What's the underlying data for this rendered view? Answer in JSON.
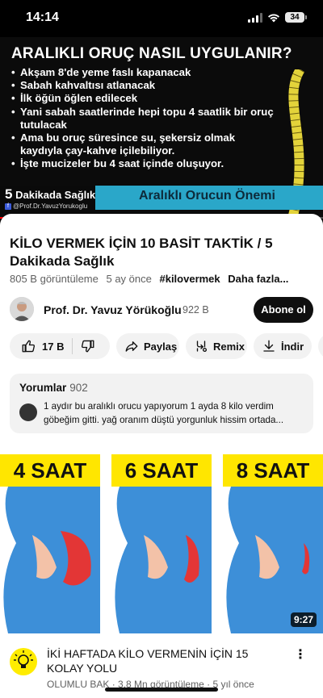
{
  "status_bar": {
    "time": "14:14",
    "battery": "34"
  },
  "player": {
    "headline": "ARALIKLI ORUÇ NASIL UYGULANIR?",
    "bullets": [
      "Akşam 8'de yeme faslı kapanacak",
      "Sabah kahvaltısı atlanacak",
      "İlk öğün öğlen edilecek",
      "Yani sabah saatlerinde hepi topu 4 saatlik bir oruç tutulacak",
      "Ama bu oruç süresince su, şekersiz olmak kaydıyla çay-kahve içilebiliyor.",
      "İşte mucizeler bu 4 saat içinde oluşuyor."
    ],
    "brand_number": "5",
    "brand_name": "Dakikada Sağlık",
    "brand_handle": "@Prof.Dr.YavuzYorukoglu",
    "subtitle": "Aralıklı Orucun Önemi",
    "progress": 0.03
  },
  "video": {
    "title": "KİLO VERMEK İÇİN 10 BASİT TAKTİK / 5 Dakikada Sağlık",
    "views": "805 B görüntüleme",
    "age": "5 ay önce",
    "hashtag": "#kilovermek",
    "more": "Daha fazla..."
  },
  "channel": {
    "name": "Prof. Dr. Yavuz Yörükoğlu",
    "subscribers": "922 B",
    "subscribe_label": "Abone ol"
  },
  "actions": {
    "likes": "17 B",
    "share": "Paylaş",
    "remix": "Remix",
    "download": "İndir"
  },
  "comments": {
    "label": "Yorumlar",
    "count": "902",
    "top_comment": "1 aydır bu aralıklı orucu yapıyorum 1 ayda 8 kilo verdim göbeğim gitti. yağ oranım düştü yorgunluk hissim ortada..."
  },
  "recommended": {
    "panels": [
      "4 SAAT",
      "6 SAAT",
      "8 SAAT"
    ],
    "duration": "9:27",
    "title": "İKİ HAFTADA KİLO VERMENİN İÇİN 15 KOLAY YOLU",
    "channel": "OLUMLU BAK",
    "views": "3,8 Mn görüntüleme",
    "age": "5 yıl önce"
  },
  "colors": {
    "accent_red": "#ff0000",
    "highlight_yellow": "#ffe600",
    "brand_blue": "#2aa7c9"
  }
}
